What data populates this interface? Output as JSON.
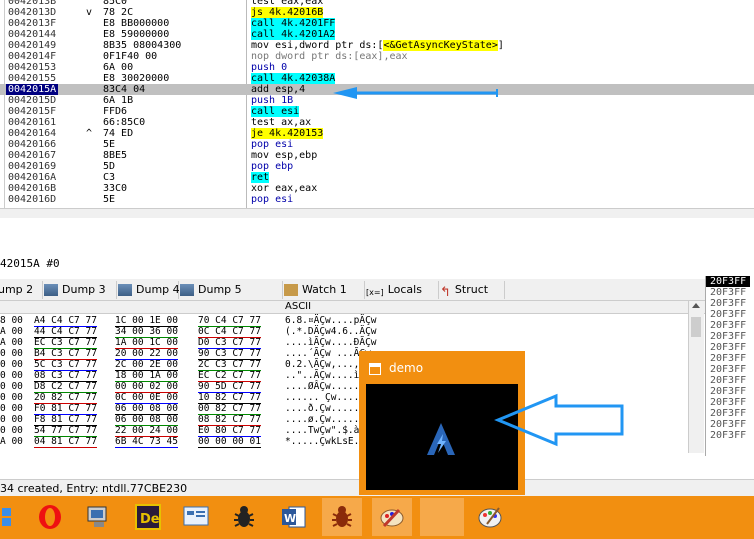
{
  "disasm": {
    "rows": [
      {
        "addr": "0042013B",
        "jmp": "",
        "bytes": "85C0",
        "instr": "test eax,eax"
      },
      {
        "addr": "0042013D",
        "jmp": "v",
        "bytes": "78 2C",
        "instr_pre": "",
        "instr_hl": "js 4k.42016B",
        "hl": "y"
      },
      {
        "addr": "0042013F",
        "jmp": "",
        "bytes": "E8 BB000000",
        "instr_hl": "call 4k.4201FF",
        "hl": "c"
      },
      {
        "addr": "00420144",
        "jmp": "",
        "bytes": "E8 59000000",
        "instr_hl": "call 4k.4201A2",
        "hl": "c"
      },
      {
        "addr": "00420149",
        "jmp": "",
        "bytes": "8B35 08004300",
        "instr_pre": "mov esi,dword ptr ds:[",
        "instr_hl": "<&GetAsyncKeyState>",
        "instr_post": "]",
        "hl": "y"
      },
      {
        "addr": "0042014F",
        "jmp": "",
        "bytes": "0F1F40 00",
        "instr": "nop dword ptr ds:[eax],eax",
        "style": "grey"
      },
      {
        "addr": "00420153",
        "jmp": "",
        "bytes": "6A 00",
        "instr": "push 0",
        "style": "blue"
      },
      {
        "addr": "00420155",
        "jmp": "",
        "bytes": "E8 30020000",
        "instr_hl": "call 4k.42038A",
        "hl": "c"
      },
      {
        "addr": "0042015A",
        "jmp": "",
        "bytes": "83C4 04",
        "instr": "add esp,4",
        "selected": true
      },
      {
        "addr": "0042015D",
        "jmp": "",
        "bytes": "6A 1B",
        "instr": "push 1B",
        "style": "blue"
      },
      {
        "addr": "0042015F",
        "jmp": "",
        "bytes": "FFD6",
        "instr_hl": "call esi",
        "hl": "c"
      },
      {
        "addr": "00420161",
        "jmp": "",
        "bytes": "66:85C0",
        "instr": "test ax,ax"
      },
      {
        "addr": "00420164",
        "jmp": "^",
        "bytes": "74 ED",
        "instr_hl": "je 4k.420153",
        "hl": "y"
      },
      {
        "addr": "00420166",
        "jmp": "",
        "bytes": "5E",
        "instr": "pop esi",
        "style": "blue"
      },
      {
        "addr": "00420167",
        "jmp": "",
        "bytes": "8BE5",
        "instr": "mov esp,ebp"
      },
      {
        "addr": "00420169",
        "jmp": "",
        "bytes": "5D",
        "instr": "pop ebp",
        "style": "blue"
      },
      {
        "addr": "0042016A",
        "jmp": "",
        "bytes": "C3",
        "instr_hl": "ret",
        "hl": "c"
      },
      {
        "addr": "0042016B",
        "jmp": "",
        "bytes": "33C0",
        "instr": "xor eax,eax"
      },
      {
        "addr": "0042016D",
        "jmp": "",
        "bytes": "5E",
        "instr": "pop esi",
        "style": "blue"
      }
    ]
  },
  "info_line": "42015A #0",
  "tabs": [
    {
      "label": "ump 2",
      "icon": "dump-icon"
    },
    {
      "label": "Dump 3",
      "icon": "dump-icon"
    },
    {
      "label": "Dump 4",
      "icon": "dump-icon"
    },
    {
      "label": "Dump 5",
      "icon": "dump-icon"
    },
    {
      "label": "Watch 1",
      "icon": "watch-icon"
    },
    {
      "label": "Locals",
      "icon": "locals-icon"
    },
    {
      "label": "Struct",
      "icon": "struct-icon"
    }
  ],
  "dump": {
    "ascii_header": "ASCII",
    "lines": [
      {
        "a": "8 00",
        "b": "A4 C4 C7 77",
        "c": "1C 00 1E 00",
        "d": "70 C4 C7 77",
        "e": "6.8.¤ÄÇw....pÄÇw"
      },
      {
        "a": "A 00",
        "b": "44 C4 C7 77",
        "c": "34 00 36 00",
        "d": "0C C4 C7 77",
        "e": "(.*.DÄÇw4.6..ÄÇw"
      },
      {
        "a": "A 00",
        "b": "EC C3 C7 77",
        "c": "1A 00 1C 00",
        "d": "D0 C3 C7 77",
        "e": "....ìÃÇw....ÐÃÇw"
      },
      {
        "a": "0 00",
        "b": "B4 C3 C7 77",
        "c": "20 00 22 00",
        "d": "90 C3 C7 77",
        "e": "....´ÃÇw ...ÃÇw"
      },
      {
        "a": "0 00",
        "b": "5C C3 C7 77",
        "c": "2C 00 2E 00",
        "d": "2C C3 C7 77",
        "e": "0.2.\\ÃÇw,...,ÃÇw"
      },
      {
        "a": "0 00",
        "b": "08 C3 C7 77",
        "c": "18 00 1A 00",
        "d": "EC C2 C7 77",
        "e": "..\"..ÃÇw....ìÂÇw"
      },
      {
        "a": "0 00",
        "b": "D8 C2 C7 77",
        "c": "00 00 02 00",
        "d": "90 5D C7 77",
        "e": "....ØÂÇw.....]Çw"
      },
      {
        "a": "0 00",
        "b": "20 82 C7 77",
        "c": "0C 00 0E 00",
        "d": "10 82 C7 77",
        "e": "...... Çw.....Çw"
      },
      {
        "a": "0 00",
        "b": "F0 81 C7 77",
        "c": "06 00 08 00",
        "d": "00 82 C7 77",
        "e": "....ð.Çw.....Çw"
      },
      {
        "a": "0 00",
        "b": "F8 81 C7 77",
        "c": "06 00 08 00",
        "d": "08 82 C7 77",
        "e": "....ø.Çw.....Çw"
      },
      {
        "a": "0 00",
        "b": "54 77 C7 77",
        "c": "22 00 24 00",
        "d": "E0 80 C7 77",
        "e": "....TwÇw\".$.àÇw"
      },
      {
        "a": "A 00",
        "b": "04 81 C7 77",
        "c": "6B 4C 73 45",
        "d": "00 00 00 01",
        "e": "*.....ÇwkLsE...."
      }
    ]
  },
  "stack": [
    "20F3FF",
    "20F3FF",
    "20F3FF",
    "20F3FF",
    "20F3FF",
    "20F3FF",
    "20F3FF",
    "20F3FF",
    "20F3FF",
    "20F3FF",
    "20F3FF",
    "20F3FF",
    "20F3FF",
    "20F3FF",
    "20F3FF"
  ],
  "status_text": "34 created, Entry: ntdll.77CBE230",
  "demo": {
    "title": "demo"
  },
  "taskbar": [
    "windows-logo",
    "opera",
    "network",
    "premiere",
    "control-panel",
    "bug",
    "word",
    "bug",
    "paint",
    "blank",
    "palette"
  ]
}
